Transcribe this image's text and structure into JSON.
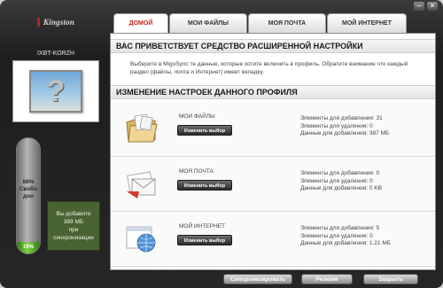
{
  "window": {
    "brand": "Kingston",
    "controls": {
      "minimize": "−",
      "close": "✕"
    }
  },
  "tabs": [
    {
      "label": "ДОМОЙ",
      "active": true
    },
    {
      "label": "МОИ ФАЙЛЫ",
      "active": false
    },
    {
      "label": "МОЯ ПОЧТА",
      "active": false
    },
    {
      "label": "МОЙ ИНТЕРНЕТ",
      "active": false
    }
  ],
  "device": {
    "name": "IXBT-KORZH",
    "placeholder": "?",
    "storage": {
      "free_label": "88%\nСвобо\nдно",
      "used_label": "10%",
      "used_fraction": 0.1
    },
    "sync_info": "Вы добавите\n389 МБ\nпри\nсинхронизации"
  },
  "welcome": {
    "title": "ВАС ПРИВЕТСТВУЕТ СРЕДСТВО РАСШИРЕННОЙ НАСТРОЙКИ",
    "text": "Выберите в MigoSync те данные, которые хотите включить в профиль. Обратите внимание что каждый раздел (файлы, почта и Интернет) имеет вкладку."
  },
  "profile": {
    "title": "ИЗМЕНЕНИЕ НАСТРОЕК ДАННОГО ПРОФИЛЯ",
    "rows": [
      {
        "title": "МОИ ФАЙЛЫ",
        "button": "Изменить выбор",
        "stats": [
          "Элементы для добавления: 31",
          "Элементы для удаления: 0",
          "Данные для добавления: 387 МБ"
        ]
      },
      {
        "title": "МОЯ ПОЧТА",
        "button": "Изменить выбор",
        "stats": [
          "Элементы для добавления: 0",
          "Элементы для удаления: 0",
          "Данные для добавления: 0 KB"
        ]
      },
      {
        "title": "МОЙ ИНТЕРНЕТ",
        "button": "Изменить выбор",
        "stats": [
          "Элементы для добавления: 5",
          "Элементы для удаления: 0",
          "Данные для добавления: 1.21 МБ"
        ]
      }
    ]
  },
  "footer": {
    "sync": "Синхронизировать",
    "resume": "Резюме",
    "close": "Закрыть"
  },
  "colors": {
    "accent": "#c7271a",
    "gauge": "#7fd442",
    "panel": "#4a6332"
  }
}
